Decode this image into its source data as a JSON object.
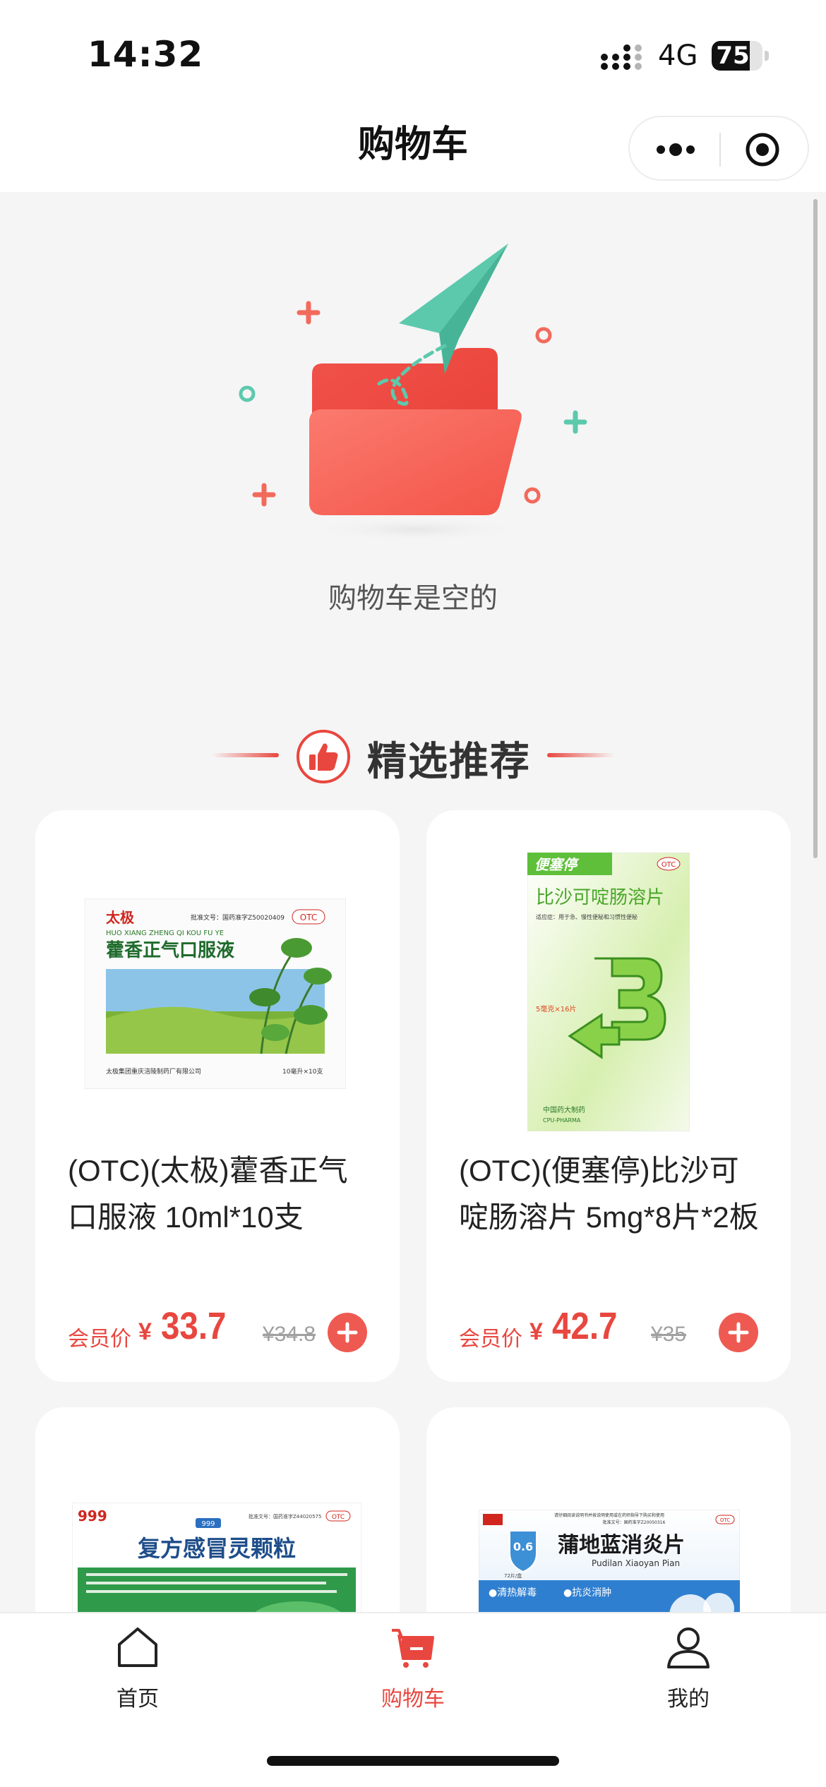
{
  "status_bar": {
    "time": "14:32",
    "network": "4G",
    "battery": "75",
    "battery_level": 0.75,
    "icons": [
      "signal-icon",
      "battery-icon"
    ]
  },
  "nav": {
    "title": "购物车",
    "capsule_icons": [
      "more-icon",
      "target-icon"
    ]
  },
  "empty_state": {
    "message": "购物车是空的",
    "illustration": "folder-paper-plane-icon"
  },
  "recommend": {
    "title": "精选推荐",
    "icon": "thumbs-up-icon"
  },
  "products": [
    {
      "name": "(OTC)(太极)藿香正气口服液 10ml*10支",
      "member_label": "会员价",
      "currency": "¥",
      "price": "33.7",
      "original_price": "¥34.8",
      "box": {
        "brand": "太极",
        "title": "藿香正气口服液",
        "pinyin": "HUO XIANG ZHENG QI KOU FU YE",
        "approval": "批准文号：国药准字Z50020409",
        "otc": "OTC",
        "spec": "10毫升×10支",
        "maker": "太极集团重庆涪陵制药厂有限公司"
      }
    },
    {
      "name": "(OTC)(便塞停)比沙可啶肠溶片 5mg*8片*2板",
      "member_label": "会员价",
      "currency": "¥",
      "price": "42.7",
      "original_price": "¥35",
      "box": {
        "brand": "便塞停",
        "title": "比沙可啶肠溶片",
        "otc": "OTC",
        "subtitle": "适应症：用于急、慢性便秘和习惯性便秘",
        "spec": "5毫克×16片",
        "maker": "中国药大制药",
        "maker_en": "CPU-PHARMA"
      }
    },
    {
      "name": "复方感冒灵颗粒",
      "box": {
        "brand": "999",
        "title": "复方感冒灵颗粒",
        "approval": "批准文号：国药准字Z44020575",
        "otc": "OTC"
      }
    },
    {
      "name": "蒲地蓝消炎片",
      "box": {
        "title": "蒲地蓝消炎片",
        "pinyin": "Pudilan Xiaoyan Pian",
        "badge": "0.6",
        "tag1": "●清热解毒",
        "tag2": "●抗炎消肿",
        "count": "72片/盒",
        "otc": "OTC",
        "notice": "请仔细阅读说明书并按说明使用或在药师指导下购买和使用",
        "approval": "批准文号：国药准字Z20050316"
      }
    }
  ],
  "tabs": [
    {
      "label": "首页",
      "icon": "home-icon"
    },
    {
      "label": "购物车",
      "icon": "cart-icon"
    },
    {
      "label": "我的",
      "icon": "user-icon"
    }
  ],
  "colors": {
    "accent": "#e8473f",
    "background": "#f5f5f5",
    "folder": "#f26a5c",
    "paper_plane": "#5cc9ad"
  }
}
